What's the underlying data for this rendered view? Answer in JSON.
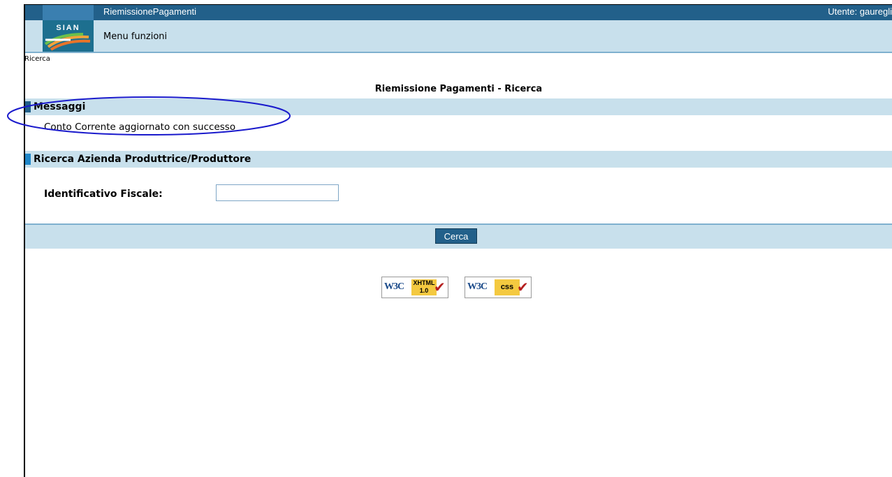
{
  "window": {
    "app_title": "RiemissionePagamenti",
    "user": "Utente: gauregli"
  },
  "logo": {
    "text": "SIAN"
  },
  "menu": {
    "label": "Menu funzioni"
  },
  "breadcrumb": "Ricerca",
  "page_title": "Riemissione Pagamenti - Ricerca",
  "messages": {
    "title": "Messaggi",
    "text": "Conto Corrente aggiornato con successo"
  },
  "search": {
    "title": "Ricerca Azienda Produttrice/Produttore",
    "field_label": "Identificativo Fiscale:",
    "field_value": "",
    "button_label": "Cerca"
  },
  "badges": {
    "xhtml": {
      "w3c": "W3C",
      "tag_line1": "XHTML",
      "tag_line2": "1.0"
    },
    "css": {
      "w3c": "W3C",
      "tag": "css"
    }
  },
  "colors": {
    "header_dark": "#22608a",
    "header_light": "#c8e0ec",
    "section_marker": "#1f86c8",
    "annotation": "#1a1acc"
  }
}
